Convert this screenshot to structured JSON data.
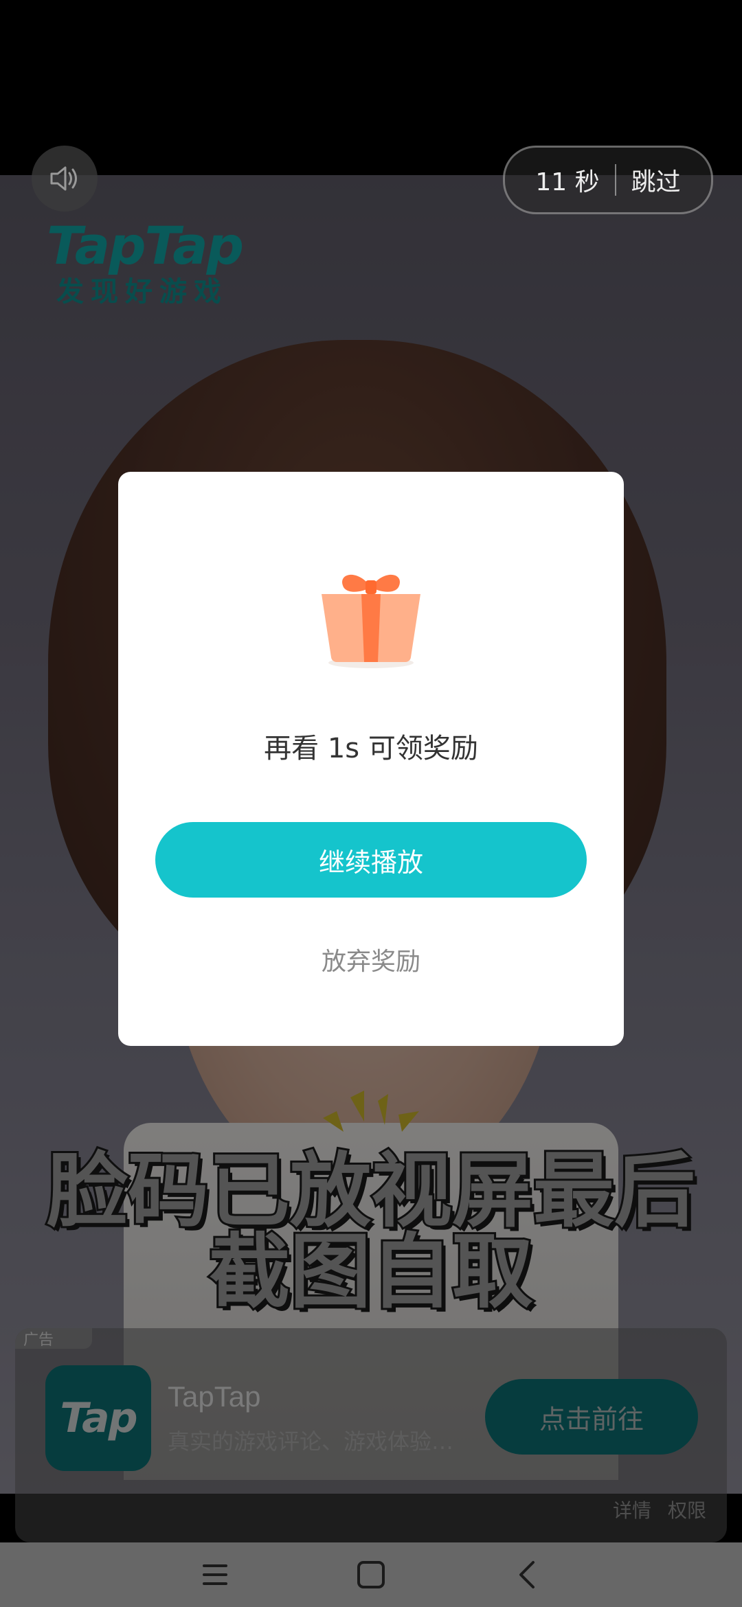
{
  "skip_timer": {
    "seconds": "11 秒",
    "skip_label": "跳过"
  },
  "logo": {
    "title": "TapTap",
    "subtitle": "发现好游戏"
  },
  "video_caption": {
    "line1": "脸码已放视屏最后",
    "line2": "截图自取"
  },
  "reward_dialog": {
    "message": "再看 1s 可领奖励",
    "continue_label": "继续播放",
    "abandon_label": "放弃奖励"
  },
  "ad": {
    "badge": "广告",
    "icon_text": "Tap",
    "app_name": "TapTap",
    "description": "真实的游戏评论、游戏体验…",
    "cta_label": "点击前往",
    "details_label": "详情",
    "permissions_label": "权限"
  },
  "icons": {
    "mute": "speaker-icon",
    "gift": "gift-icon",
    "nav_menu": "menu-icon",
    "nav_home": "home-icon",
    "nav_back": "back-icon"
  },
  "colors": {
    "accent": "#15c4cc",
    "brand_teal": "#12a5a5",
    "dialog_bg": "#ffffff"
  }
}
